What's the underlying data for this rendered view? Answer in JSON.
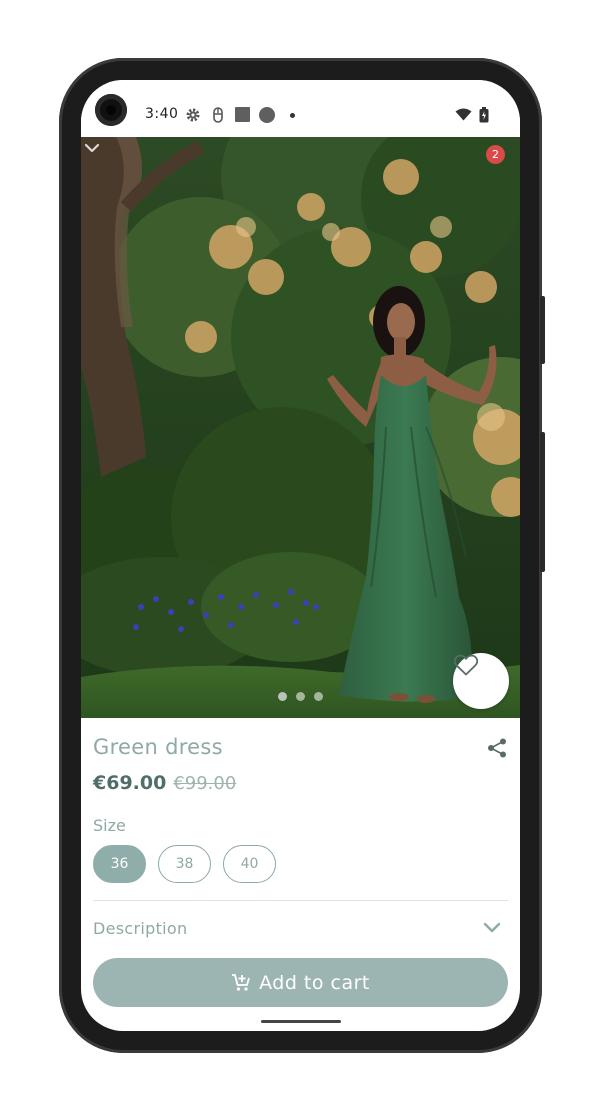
{
  "status_bar": {
    "time": "3:40",
    "icons": [
      "gear-icon",
      "usb-icon",
      "square-icon",
      "circle-icon",
      "dot-icon",
      "wifi-icon",
      "battery-icon"
    ]
  },
  "hero": {
    "cart_badge_count": "2",
    "carousel_count": 3,
    "carousel_active_index": 0,
    "image_description_icon": "photo"
  },
  "product": {
    "title": "Green dress",
    "price_current": "€69.00",
    "price_original": "€99.00",
    "size_label": "Size",
    "sizes": [
      "36",
      "38",
      "40"
    ],
    "selected_size": "36",
    "description_label": "Description",
    "add_to_cart_label": "Add to cart"
  },
  "colors": {
    "accent": "#8fa9a6",
    "button": "#9cb5b2",
    "price": "#4f6e69",
    "badge": "#d94a4a"
  }
}
